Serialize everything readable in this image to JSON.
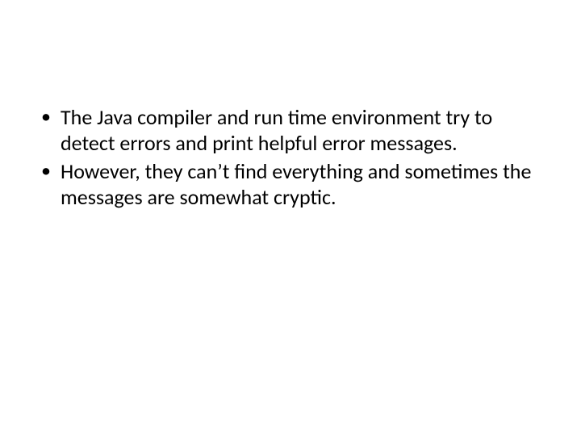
{
  "slide": {
    "bullets": [
      "The Java compiler and run time environment try to detect errors and print helpful error messages.",
      "However, they can’t find everything and sometimes the messages are somewhat cryptic."
    ]
  }
}
